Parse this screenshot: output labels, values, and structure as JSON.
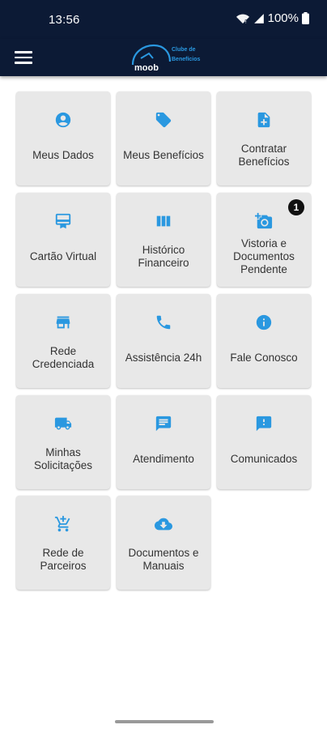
{
  "status": {
    "time": "13:56",
    "battery": "100%"
  },
  "app": {
    "logo_text": "moob",
    "logo_subtitle_1": "Clube de",
    "logo_subtitle_2": "Benefícios"
  },
  "colors": {
    "accent": "#2a98e0",
    "bar": "#0c1a35",
    "tile": "#e8e8e8"
  },
  "tiles": [
    {
      "label": "Meus Dados",
      "icon": "account-circle-icon"
    },
    {
      "label": "Meus Benefícios",
      "icon": "tag-icon"
    },
    {
      "label": "Contratar Benefícios",
      "icon": "note-add-icon"
    },
    {
      "label": "Cartão Virtual",
      "icon": "card-membership-icon"
    },
    {
      "label": "Histórico Financeiro",
      "icon": "columns-icon"
    },
    {
      "label": "Vistoria e Documentos Pendente",
      "icon": "camera-add-icon",
      "badge": "1"
    },
    {
      "label": "Rede Credenciada",
      "icon": "store-icon"
    },
    {
      "label": "Assistência 24h",
      "icon": "phone-icon"
    },
    {
      "label": "Fale Conosco",
      "icon": "info-icon"
    },
    {
      "label": "Minhas Solicitações",
      "icon": "truck-icon"
    },
    {
      "label": "Atendimento",
      "icon": "chat-icon"
    },
    {
      "label": "Comunicados",
      "icon": "feedback-icon"
    },
    {
      "label": "Rede de Parceiros",
      "icon": "cart-add-icon"
    },
    {
      "label": "Documentos e Manuais",
      "icon": "cloud-download-icon"
    }
  ]
}
